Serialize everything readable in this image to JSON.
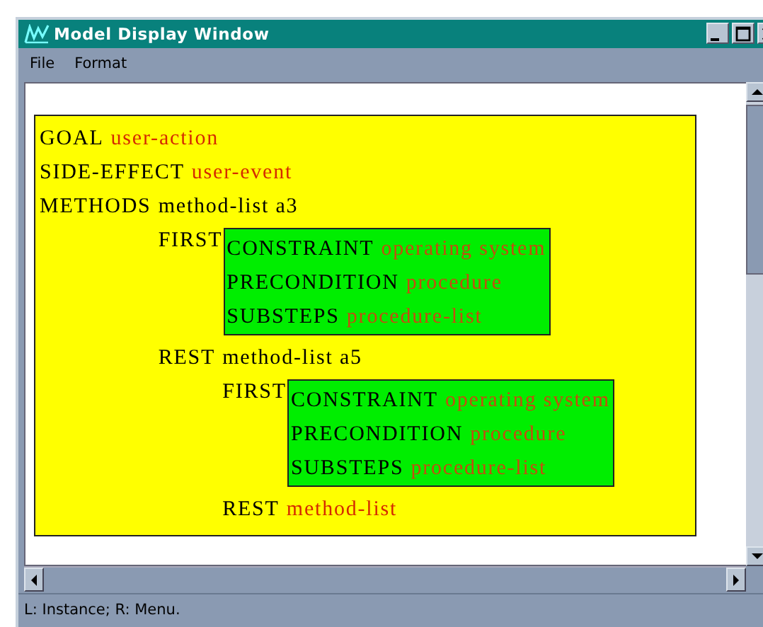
{
  "window": {
    "title": "Model Display Window"
  },
  "menu": [
    "File",
    "Format"
  ],
  "frame": {
    "slots": [
      {
        "key": "GOAL",
        "value": "user-action",
        "kind": "variable"
      },
      {
        "key": "SIDE-EFFECT",
        "value": "user-event",
        "kind": "variable"
      },
      {
        "key": "METHODS",
        "value": "method-list a3",
        "kind": "instance",
        "items": [
          {
            "label": "FIRST",
            "slots": [
              {
                "key": "CONSTRAINT",
                "value": "operating system",
                "kind": "variable"
              },
              {
                "key": "PRECONDITION",
                "value": "procedure",
                "kind": "variable"
              },
              {
                "key": "SUBSTEPS",
                "value": "procedure-list",
                "kind": "variable"
              }
            ]
          },
          {
            "label": "REST",
            "value": "method-list a5",
            "kind": "instance",
            "items": [
              {
                "label": "FIRST",
                "slots": [
                  {
                    "key": "CONSTRAINT",
                    "value": "operating system",
                    "kind": "variable"
                  },
                  {
                    "key": "PRECONDITION",
                    "value": "procedure",
                    "kind": "variable"
                  },
                  {
                    "key": "SUBSTEPS",
                    "value": "procedure-list",
                    "kind": "variable"
                  }
                ]
              },
              {
                "label": "REST",
                "value": "method-list",
                "kind": "variable"
              }
            ]
          }
        ]
      }
    ]
  },
  "status_bar": "L: Instance; R: Menu."
}
